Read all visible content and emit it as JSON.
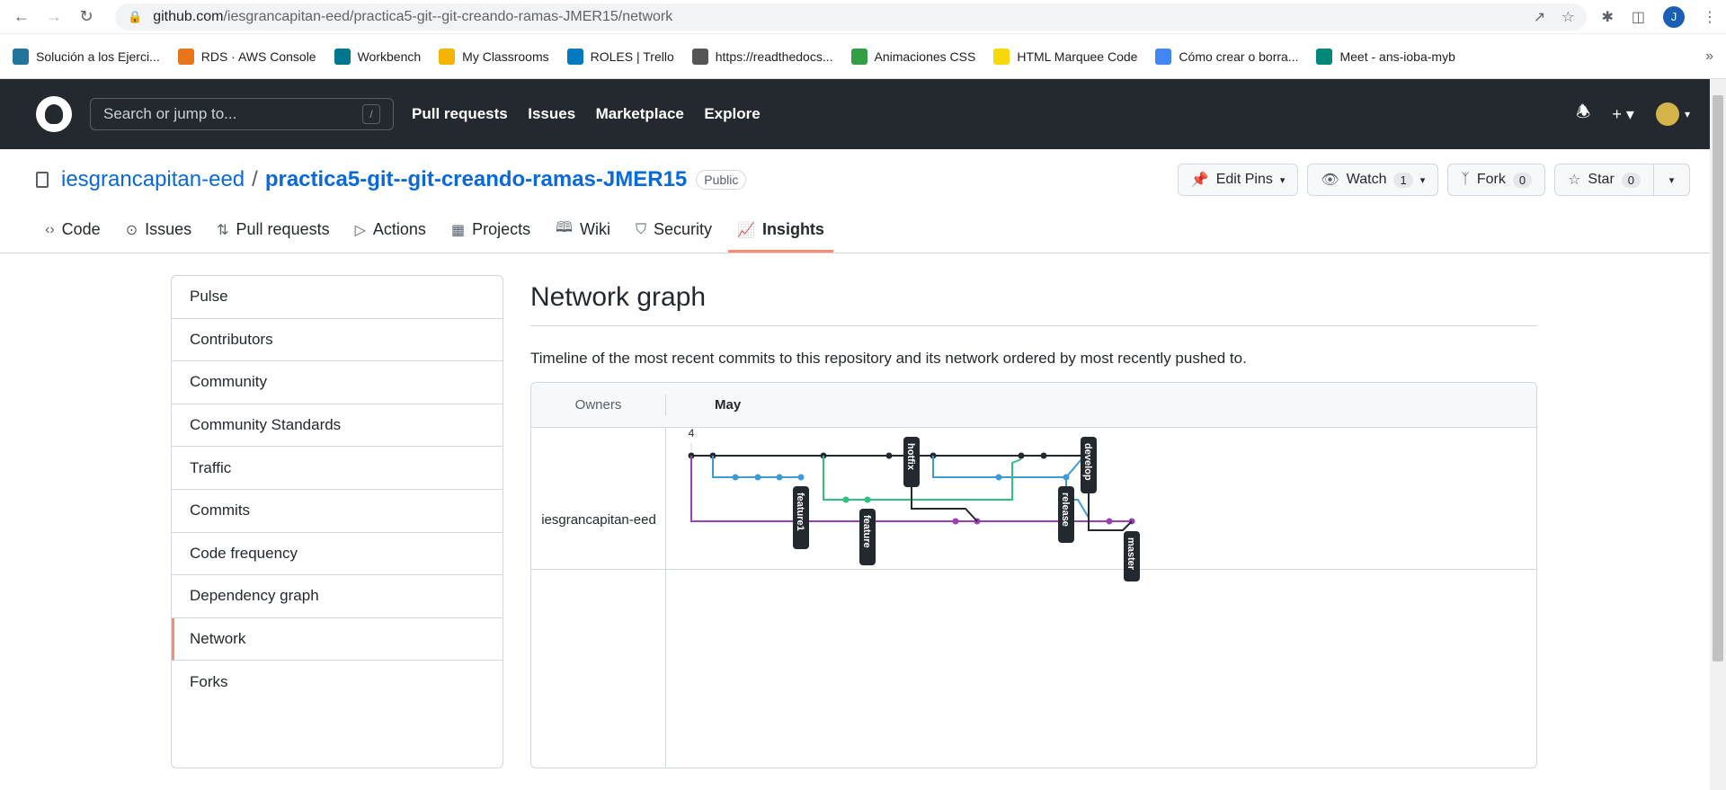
{
  "browser": {
    "url_host": "github.com",
    "url_path": "/iesgrancapitan-eed/practica5-git--git-creando-ramas-JMER15/network",
    "profile_initial": "J",
    "bookmarks": [
      {
        "label": "Solución a los Ejerci...",
        "color": "#21759b",
        "icon": "wordpress-icon"
      },
      {
        "label": "RDS · AWS Console",
        "color": "#e8751a",
        "icon": "aws-rds-icon"
      },
      {
        "label": "Workbench",
        "color": "#00758f",
        "icon": "workbench-icon"
      },
      {
        "label": "My Classrooms",
        "color": "#f5b400",
        "icon": "classroom-icon"
      },
      {
        "label": "ROLES | Trello",
        "color": "#0079bf",
        "icon": "trello-icon"
      },
      {
        "label": "https://readthedocs...",
        "color": "#555555",
        "icon": "readthedocs-icon"
      },
      {
        "label": "Animaciones CSS",
        "color": "#2f9e44",
        "icon": "w3-icon"
      },
      {
        "label": "HTML Marquee Code",
        "color": "#f5d90a",
        "icon": "marquee-icon"
      },
      {
        "label": "Cómo crear o borra...",
        "color": "#4285f4",
        "icon": "search-help-icon"
      },
      {
        "label": "Meet - ans-ioba-myb",
        "color": "#00897b",
        "icon": "meet-icon"
      }
    ]
  },
  "header": {
    "search_placeholder": "Search or jump to...",
    "search_shortcut": "/",
    "nav": [
      "Pull requests",
      "Issues",
      "Marketplace",
      "Explore"
    ]
  },
  "repo": {
    "owner": "iesgrancapitan-eed",
    "separator": "/",
    "name": "practica5-git--git-creando-ramas-JMER15",
    "visibility": "Public",
    "edit_pins": "Edit Pins",
    "watch": "Watch",
    "watch_count": "1",
    "fork": "Fork",
    "fork_count": "0",
    "star": "Star",
    "star_count": "0"
  },
  "tabs": [
    {
      "label": "Code",
      "icon": "code-icon"
    },
    {
      "label": "Issues",
      "icon": "issue-icon"
    },
    {
      "label": "Pull requests",
      "icon": "pull-request-icon"
    },
    {
      "label": "Actions",
      "icon": "play-icon"
    },
    {
      "label": "Projects",
      "icon": "table-icon"
    },
    {
      "label": "Wiki",
      "icon": "book-icon"
    },
    {
      "label": "Security",
      "icon": "shield-icon"
    },
    {
      "label": "Insights",
      "icon": "graph-icon"
    }
  ],
  "active_tab": "Insights",
  "sidenav": [
    "Pulse",
    "Contributors",
    "Community",
    "Community Standards",
    "Traffic",
    "Commits",
    "Code frequency",
    "Dependency graph",
    "Network",
    "Forks"
  ],
  "selected_sidenav": "Network",
  "main": {
    "title": "Network graph",
    "description": "Timeline of the most recent commits to this repository and its network ordered by most recently pushed to."
  },
  "graph": {
    "owners_header": "Owners",
    "month": "May",
    "day": "4",
    "owner": "iesgrancapitan-eed",
    "branch_labels": [
      "feature1",
      "feature",
      "hotfix",
      "release",
      "develop",
      "master"
    ],
    "colors": {
      "develop": "#24292f",
      "feature1": "#3d9ad6",
      "feature": "#2ec27e",
      "master": "#9b3fb5",
      "hotfix": "#24292f"
    }
  }
}
